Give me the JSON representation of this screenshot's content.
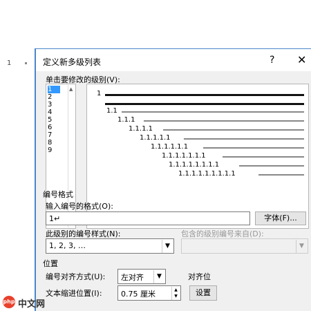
{
  "document": {
    "paragraph_number": "1"
  },
  "dialog": {
    "title": "定义新多级列表",
    "help_glyph": "?",
    "close_glyph": "✕"
  },
  "level_section": {
    "label": "单击要修改的级别(V):",
    "levels": [
      "1",
      "2",
      "3",
      "4",
      "5",
      "6",
      "7",
      "8",
      "9"
    ],
    "selected": "1"
  },
  "preview": {
    "rows": [
      "1",
      "",
      "1.1",
      "1.1.1",
      "1.1.1.1",
      "1.1.1.1.1",
      "1.1.1.1.1.1",
      "1.1.1.1.1.1.1",
      "1.1.1.1.1.1.1.1",
      "1.1.1.1.1.1.1.1.1"
    ]
  },
  "number_format": {
    "section_label": "编号格式",
    "input_label": "输入编号的格式(O):",
    "input_value": "1↵",
    "font_button": "字体(F)...",
    "style_label": "此级别的编号样式(N):",
    "style_value": "1, 2, 3, …",
    "include_label": "包含的级别编号来自(D):",
    "include_value": ""
  },
  "position": {
    "section_label": "位置",
    "align_label": "编号对齐方式(U):",
    "align_value": "左对齐",
    "align_at_label": "对齐位",
    "indent_label": "文本缩进位置(I):",
    "indent_value": "0.75 厘米",
    "set_button": "设置"
  },
  "watermark": {
    "badge": "php",
    "text": "中文网"
  }
}
